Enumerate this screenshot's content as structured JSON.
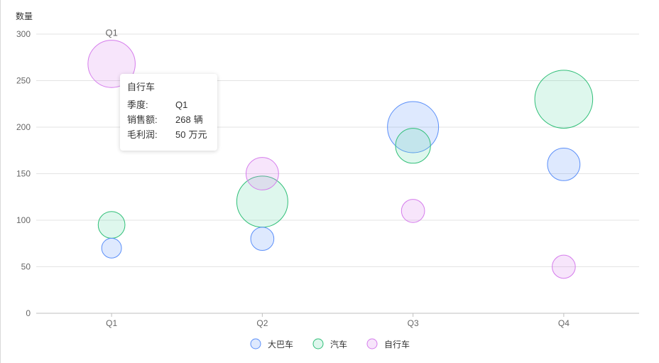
{
  "chart_data": {
    "type": "scatter",
    "ylabel": "数量",
    "ylim": [
      0,
      300
    ],
    "yticks": [
      0,
      50,
      100,
      150,
      200,
      250,
      300
    ],
    "categories": [
      "Q1",
      "Q2",
      "Q3",
      "Q4"
    ],
    "series": [
      {
        "name": "大巴车",
        "color": "#5B8FF9",
        "points": [
          {
            "x": "Q1",
            "y": 70,
            "profit": 5
          },
          {
            "x": "Q2",
            "y": 80,
            "profit": 8
          },
          {
            "x": "Q3",
            "y": 200,
            "profit": 60
          },
          {
            "x": "Q4",
            "y": 160,
            "profit": 20
          }
        ]
      },
      {
        "name": "汽车",
        "color": "#5AD8A6",
        "stroke": "#30BF78",
        "points": [
          {
            "x": "Q1",
            "y": 95,
            "profit": 12
          },
          {
            "x": "Q2",
            "y": 120,
            "profit": 60
          },
          {
            "x": "Q3",
            "y": 180,
            "profit": 24
          },
          {
            "x": "Q4",
            "y": 230,
            "profit": 80
          }
        ]
      },
      {
        "name": "自行车",
        "color": "#D57CEC",
        "points": [
          {
            "x": "Q1",
            "y": 268,
            "profit": 50
          },
          {
            "x": "Q2",
            "y": 150,
            "profit": 20
          },
          {
            "x": "Q3",
            "y": 110,
            "profit": 8
          },
          {
            "x": "Q4",
            "y": 50,
            "profit": 8
          }
        ]
      }
    ],
    "legend": [
      "大巴车",
      "汽车",
      "自行车"
    ],
    "legend_position": "bottom-center",
    "hover_label": "Q1",
    "grid": true
  },
  "tooltip": {
    "title": "自行车",
    "rows": [
      {
        "key": "季度:",
        "value": "Q1",
        "unit": ""
      },
      {
        "key": "销售额:",
        "value": "268",
        "unit": "辆"
      },
      {
        "key": "毛利润:",
        "value": "50",
        "unit": "万元"
      }
    ]
  }
}
